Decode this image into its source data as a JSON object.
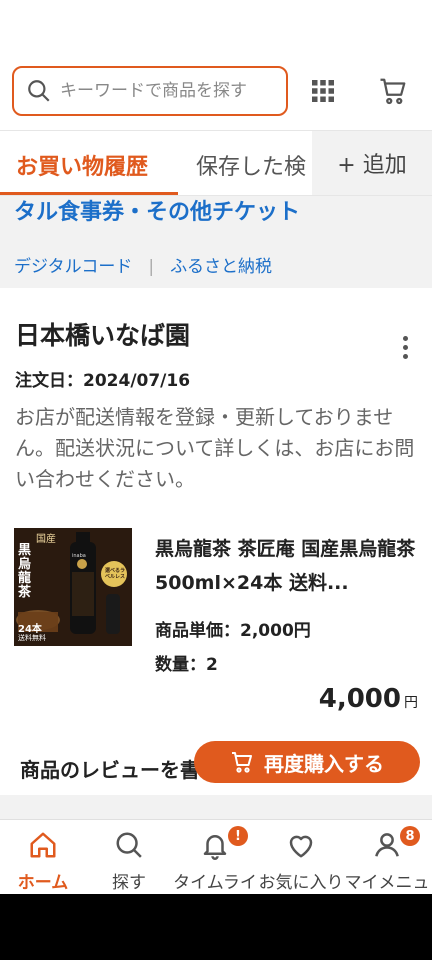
{
  "colors": {
    "accent": "#e05a1e",
    "link": "#1c6fc9"
  },
  "search": {
    "placeholder": "キーワードで商品を探す"
  },
  "header": {
    "grid_icon": "grid-icon",
    "cart_icon": "cart-icon"
  },
  "tabs": [
    {
      "label": "お買い物履歴",
      "active": true
    },
    {
      "label": "保存した検"
    }
  ],
  "tabs_add_label": "+ 追加",
  "category": {
    "title": "タル食事券・その他チケット",
    "links": [
      "デジタルコード",
      "ふるさと納税"
    ],
    "separator": "|"
  },
  "order": {
    "shop_name": "日本橋いなば園",
    "date": "注文日：2024/07/16",
    "notice": "お店が配送情報を登録・更新しておりません。配送状況について詳しくは、お店にお問い合わせください。",
    "product": {
      "name": "黒烏龍茶 茶匠庵 国産黒烏龍茶 500ml×24本 送料...",
      "unit_price": "商品単価：2,000円",
      "quantity": "数量：2",
      "image_labels": {
        "top": "国産",
        "main": "黒烏龍茶",
        "count": "24本",
        "sub": "送料無料",
        "badge": "選べるラベルレス",
        "brand": "inaba"
      }
    },
    "total": "4,000",
    "total_unit": "円",
    "review_prompt": "商品のレビューを書",
    "rebuy_label": "再度購入する"
  },
  "bottom_nav": [
    {
      "label": "ホーム",
      "icon": "home-icon",
      "active": true
    },
    {
      "label": "探す",
      "icon": "search-icon"
    },
    {
      "label": "タイムライ",
      "icon": "bell-icon",
      "badge": "!"
    },
    {
      "label": "お気に入り",
      "icon": "heart-icon"
    },
    {
      "label": "マイメニュ",
      "icon": "user-icon",
      "badge": "8"
    }
  ]
}
